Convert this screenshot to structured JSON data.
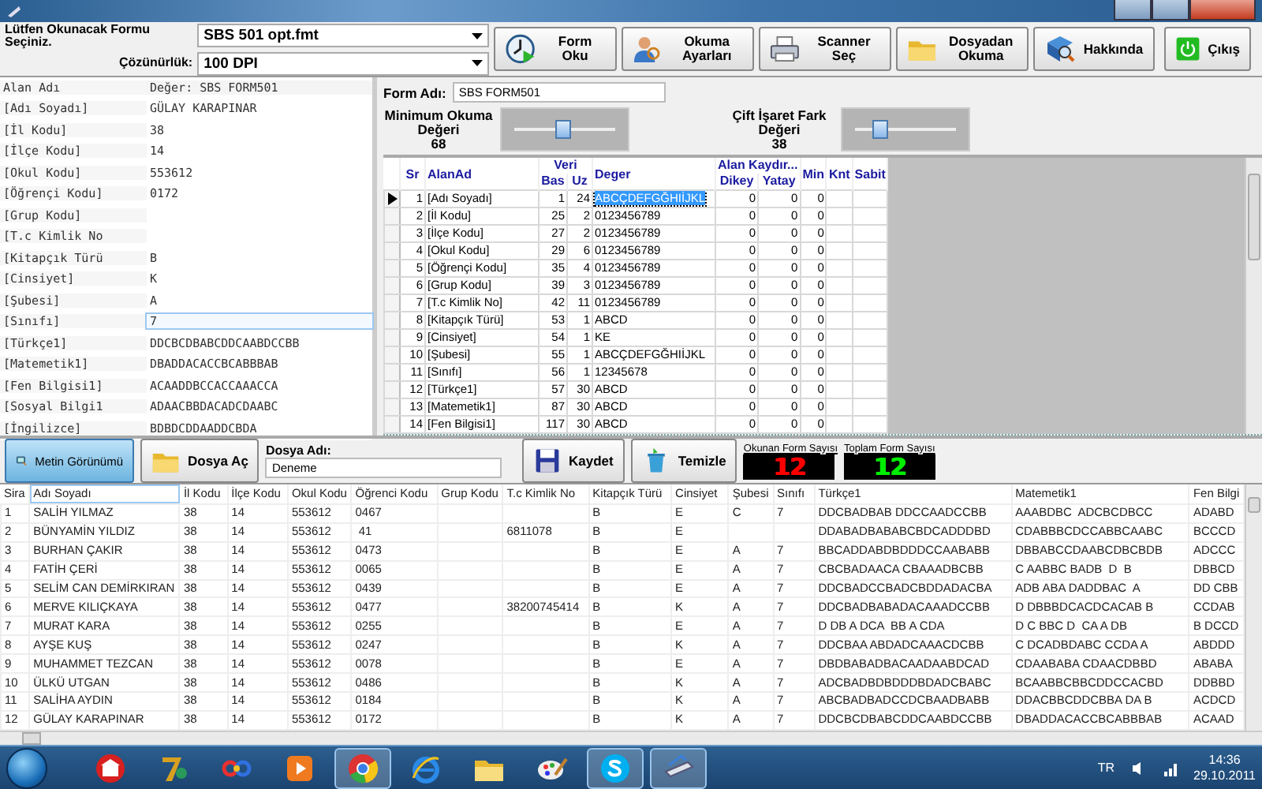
{
  "toolbar": {
    "form_label": "Lütfen Okunacak Formu Seçiniz.",
    "form_select": "SBS 501 opt.fmt",
    "resolution_label": "Çözünürlük:",
    "resolution_select": "100 DPI",
    "buttons": [
      "Form Oku",
      "Okuma Ayarları",
      "Scanner Seç",
      "Dosyadan Okuma",
      "Hakkında"
    ],
    "exit_button": "Çıkış"
  },
  "fields_panel": {
    "header": [
      "Alan Adı",
      "Değer: SBS FORM501"
    ],
    "rows": [
      {
        "key": "[Adı Soyadı]",
        "value": "GÜLAY KARAPINAR",
        "selected": false
      },
      {
        "key": "[İl Kodu]",
        "value": "38",
        "selected": false
      },
      {
        "key": "[İlçe Kodu]",
        "value": "14",
        "selected": false
      },
      {
        "key": "[Okul Kodu]",
        "value": "553612",
        "selected": false
      },
      {
        "key": "[Öğrençi Kodu]",
        "value": "0172",
        "selected": false
      },
      {
        "key": "[Grup Kodu]",
        "selected": false
      },
      {
        "key": "[T.c Kimlik No",
        "selected": false
      },
      {
        "key": "[Kitapçık Türü",
        "value": "B",
        "selected": false
      },
      {
        "key": "[Cinsiyet]",
        "value": "K",
        "selected": false
      },
      {
        "key": "[Şubesi]",
        "value": "A",
        "selected": false
      },
      {
        "key": "[Sınıfı]",
        "value": "7",
        "selected": true
      },
      {
        "key": "[Türkçe1]",
        "value": "DDCBCDBABCDDCAABDCCBB",
        "selected": false
      },
      {
        "key": "[Matemetik1]",
        "value": "DBADDACACCBCABBBAB",
        "selected": false
      },
      {
        "key": "[Fen Bilgisi1]",
        "value": "ACAADDBCCACCAAACCA",
        "selected": false
      },
      {
        "key": "[Sosyal Bilgi1",
        "value": "ADAACBBDACADCDAABC",
        "selected": false
      },
      {
        "key": "[İngilizce]",
        "value": "BDBDCDDAADDCBDA",
        "selected": false
      }
    ]
  },
  "form_settings": {
    "form_name_label": "Form Adı:",
    "form_name": "SBS FORM501",
    "sliders": [
      {
        "label": "Minimum Okuma Değeri",
        "reading": "68",
        "level": 0.48
      },
      {
        "label": "Çift İşaret Fark Değeri",
        "reading": "38",
        "level": 0.25
      }
    ]
  },
  "field_grid": {
    "headers": {
      "sr": "Sr",
      "name": "AlanAd",
      "data_group": "Veri",
      "start": "Bas",
      "length": "Uz",
      "value": "Deger",
      "shift_group": "Alan Kaydır...",
      "vertical": "Dikey",
      "horizontal": "Yatay",
      "min": "Min",
      "knt": "Knt",
      "fixed": "Sabit"
    },
    "rows": [
      {
        "cells": [
          "1",
          "[Adı Soyadı]",
          "1",
          "24",
          "ABCÇDEFGĞHIİJKL",
          "0",
          "0",
          "0"
        ],
        "selected": true
      },
      {
        "cells": [
          "2",
          "[İl Kodu]",
          "25",
          "2",
          "0123456789",
          "0",
          "0",
          "0"
        ],
        "selected": false
      },
      {
        "cells": [
          "3",
          "[İlçe Kodu]",
          "27",
          "2",
          "0123456789",
          "0",
          "0",
          "0"
        ],
        "selected": false
      },
      {
        "cells": [
          "4",
          "[Okul Kodu]",
          "29",
          "6",
          "0123456789",
          "0",
          "0",
          "0"
        ],
        "selected": false
      },
      {
        "cells": [
          "5",
          "[Öğrençi Kodu]",
          "35",
          "4",
          "0123456789",
          "0",
          "0",
          "0"
        ],
        "selected": false
      },
      {
        "cells": [
          "6",
          "[Grup Kodu]",
          "39",
          "3",
          "0123456789",
          "0",
          "0",
          "0"
        ],
        "selected": false
      },
      {
        "cells": [
          "7",
          "[T.c Kimlik No]",
          "42",
          "11",
          "0123456789",
          "0",
          "0",
          "0"
        ],
        "selected": false
      },
      {
        "cells": [
          "8",
          "[Kitapçık Türü]",
          "53",
          "1",
          "ABCD",
          "0",
          "0",
          "0"
        ],
        "selected": false
      },
      {
        "cells": [
          "9",
          "[Cinsiyet]",
          "54",
          "1",
          "KE",
          "0",
          "0",
          "0"
        ],
        "selected": false
      },
      {
        "cells": [
          "10",
          "[Şubesi]",
          "55",
          "1",
          "ABCÇDEFGĞHIİJKL",
          "0",
          "0",
          "0"
        ],
        "selected": false
      },
      {
        "cells": [
          "11",
          "[Sınıfı]",
          "56",
          "1",
          "12345678",
          "0",
          "0",
          "0"
        ],
        "selected": false
      },
      {
        "cells": [
          "12",
          "[Türkçe1]",
          "57",
          "30",
          "ABCD",
          "0",
          "0",
          "0"
        ],
        "selected": false
      },
      {
        "cells": [
          "13",
          "[Matemetik1]",
          "87",
          "30",
          "ABCD",
          "0",
          "0",
          "0"
        ],
        "selected": false
      },
      {
        "cells": [
          "14",
          "[Fen Bilgisi1]",
          "117",
          "30",
          "ABCD",
          "0",
          "0",
          "0"
        ],
        "selected": false
      }
    ]
  },
  "file_bar": {
    "view_buttons": [
      {
        "label": "Metin Görünümü",
        "selected": true
      },
      {
        "label": "Dosya Aç",
        "selected": false
      }
    ],
    "file_name_label": "Dosya Adı:",
    "file_name": "Deneme",
    "actions": [
      "Kaydet",
      "Temizle"
    ],
    "counters": [
      {
        "label": "Okunan Form Sayısı",
        "value": "12",
        "color": "#ff0000"
      },
      {
        "label": "Toplam Form Sayısı",
        "value": "12",
        "color": "#00ee00"
      }
    ]
  },
  "results": {
    "columns": [
      "Sira",
      "Adı Soyadı",
      "İl Kodu",
      "İlçe Kodu",
      "Okul Kodu",
      "Öğrenci Kodu",
      "Grup Kodu",
      "T.c Kimlik No",
      "Kitapçık Türü",
      "Cinsiyet",
      "Şubesi",
      "Sınıfı",
      "Türkçe1",
      "Matemetik1",
      "Fen Bilgi"
    ],
    "rows": [
      [
        "1",
        "SALİH YILMAZ",
        "38",
        "14",
        "553612",
        "0467",
        "",
        "",
        "B",
        "E",
        "C",
        "7",
        "DDCBADBAB DDCCAADCCBB",
        "AAABDBC  ADCBCDBCC",
        "ADABD"
      ],
      [
        "2",
        "BÜNYAMİN YILDIZ",
        "38",
        "14",
        "553612",
        " 41",
        "",
        "6811078",
        "B",
        "E",
        "",
        "",
        "DDABADBABABCBDCADDDBD",
        "CDABBBCDCCABBCAABC",
        "BCCCD"
      ],
      [
        "3",
        "BURHAN ÇAKIR",
        "38",
        "14",
        "553612",
        "0473",
        "",
        "",
        "B",
        "E",
        "A",
        "7",
        "BBCADDABDBDDDCCAABABB",
        "DBBABCCDAABCDBCBDB",
        "ADCCC"
      ],
      [
        "4",
        "FATİH ÇERİ",
        "38",
        "14",
        "553612",
        "0065",
        "",
        "",
        "B",
        "E",
        "A",
        "7",
        "CBCBADAACA CBAAADBCBB",
        "C AABBC BADB  D  B",
        "DBBCD"
      ],
      [
        "5",
        "SELİM CAN DEMİRKIRAN",
        "38",
        "14",
        "553612",
        "0439",
        "",
        "",
        "B",
        "E",
        "A",
        "7",
        "DDCBADCCBADCBDDADACBA",
        "ADB ABA DADDBAC  A",
        "DD CBB"
      ],
      [
        "6",
        "MERVE KILIÇKAYA",
        "38",
        "14",
        "553612",
        "0477",
        "",
        "38200745414",
        "B",
        "K",
        "A",
        "7",
        "DDCBADBABADACAAADCCBB",
        "D DBBBDCACDCACAB B",
        "CCDAB"
      ],
      [
        "7",
        "MURAT KARA",
        "38",
        "14",
        "553612",
        "0255",
        "",
        "",
        "B",
        "E",
        "A",
        "7",
        "D DB A DCA  BB A CDA",
        "D C BBC D  CA A DB",
        "B DCCD"
      ],
      [
        "8",
        "AYŞE KUŞ",
        "38",
        "14",
        "553612",
        "0247",
        "",
        "",
        "B",
        "K",
        "A",
        "7",
        "DDCBAA ABDADCAAACDCBB",
        "C DCADBDABC CCDA A",
        "ABDDD"
      ],
      [
        "9",
        "MUHAMMET TEZCAN",
        "38",
        "14",
        "553612",
        "0078",
        "",
        "",
        "B",
        "E",
        "A",
        "7",
        "DBDBABADBACAADAABDCAD",
        "CDAABABA CDAACDBBD",
        "ABABA"
      ],
      [
        "10",
        "ÜLKÜ UTGAN",
        "38",
        "14",
        "553612",
        "0486",
        "",
        "",
        "B",
        "K",
        "A",
        "7",
        "ADCBADBDBDDDBDADCBABC",
        "BCAABBCBBCDDCCACBD",
        "DDBBD"
      ],
      [
        "11",
        "SALİHA AYDIN",
        "38",
        "14",
        "553612",
        "0184",
        "",
        "",
        "B",
        "K",
        "A",
        "7",
        "ABCBADBADCCDCBAADBABB",
        "DDACBBCDDCBBA DA B",
        "ACDCD"
      ],
      [
        "12",
        "GÜLAY KARAPINAR",
        "38",
        "14",
        "553612",
        "0172",
        "",
        "",
        "B",
        "K",
        "A",
        "7",
        "DDCBCDBABCDDCAABDCCBB",
        "DBADDACACCBCABBBAB",
        "ACAAD"
      ]
    ]
  },
  "taskbar": {
    "apps": [
      {
        "active": false
      },
      {
        "active": false
      },
      {
        "active": false
      },
      {
        "active": false
      },
      {
        "active": true
      },
      {
        "active": false
      },
      {
        "active": false
      },
      {
        "active": false
      },
      {
        "active": true
      },
      {
        "active": true
      }
    ],
    "language": "TR",
    "time": "14:36",
    "date": "29.10.2011"
  }
}
